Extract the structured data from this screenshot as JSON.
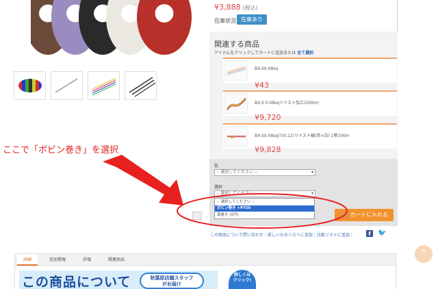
{
  "product": {
    "price": "¥3,888",
    "tax_note": "(税込)",
    "stock_label": "在庫状況:",
    "stock_status": "在庫あり",
    "thumbnails": [
      "thumb-coils",
      "thumb-cable",
      "thumb-multicolor",
      "thumb-wires"
    ]
  },
  "related": {
    "title": "関連する商品",
    "note": "アイテムをクリックしてカートに追加または",
    "note_link": "全て選択",
    "items": [
      {
        "name": "BX-S0.08sq",
        "price": "¥43"
      },
      {
        "name": "BX-S 0.08sqツイスト加工(200m)",
        "price": "¥9,720"
      },
      {
        "name": "BX-S0.08sq(7/0.12)ツイスト線(赤×白) 1巻100m",
        "price": "¥9,828"
      }
    ]
  },
  "options": {
    "color_label": "色",
    "color_placeholder": "-- 選択してください --",
    "select_label": "選択",
    "select_placeholder": "-- 選択してください --",
    "dropdown": [
      {
        "label": "-- 選択してください --",
        "selected": false
      },
      {
        "label": "ボビン巻き +¥756",
        "selected": true
      },
      {
        "label": "束巻き (0円)",
        "selected": false
      }
    ]
  },
  "cart_button": "カートに入れる",
  "links": {
    "inquiry": "この商品について問い合わせ",
    "wishlist": "欲しいものリストに追加",
    "compare": "比較リストに追加"
  },
  "annotation": {
    "text": "ここで「ボビン巻き」を選択",
    "color": "#e02020"
  },
  "tabs": [
    "詳細",
    "追加情報",
    "評価",
    "関連商品"
  ],
  "banner": {
    "text": "この商品について",
    "badge_line1": "秋葉原店舗スタッフ",
    "badge_line2": "がお届け",
    "circle_line1": "詳しくは",
    "circle_line2": "クリック!"
  },
  "colors": {
    "price": "#e04343",
    "accent": "#f2912d",
    "stock_badge": "#3f8fc7",
    "dropdown_selected": "#2d6bd0"
  }
}
